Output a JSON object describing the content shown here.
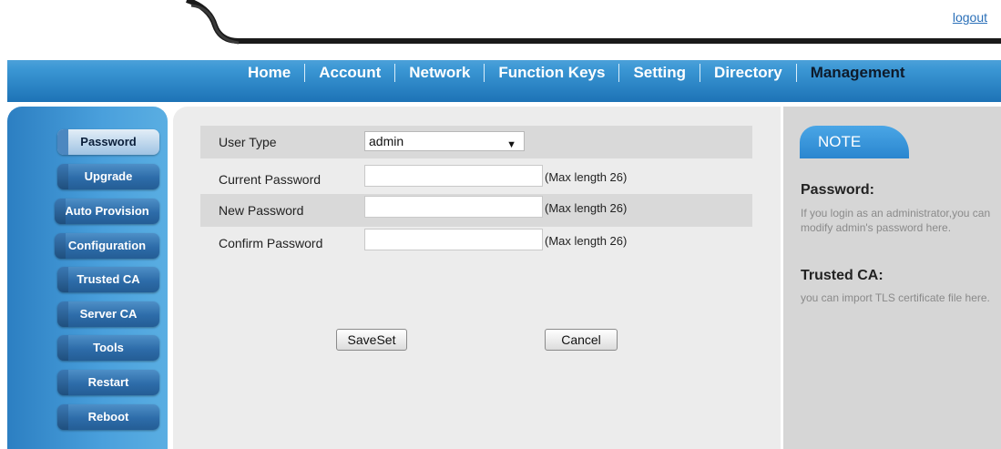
{
  "header": {
    "logout_label": "logout",
    "nav": [
      "Home",
      "Account",
      "Network",
      "Function Keys",
      "Setting",
      "Directory",
      "Management"
    ],
    "active_nav": "Management"
  },
  "sidebar": {
    "items": [
      "Password",
      "Upgrade",
      "Auto Provision",
      "Configuration",
      "Trusted CA",
      "Server CA",
      "Tools",
      "Restart",
      "Reboot"
    ],
    "active": "Password"
  },
  "form": {
    "user_type_label": "User Type",
    "user_type_value": "admin",
    "current_password_label": "Current Password",
    "new_password_label": "New Password",
    "confirm_password_label": "Confirm Password",
    "max_length_hint": "(Max length 26)",
    "save_label": "SaveSet",
    "cancel_label": "Cancel"
  },
  "note": {
    "title": "NOTE",
    "sections": [
      {
        "heading": "Password:",
        "text": "If you login as an administrator,you can modify admin's password here."
      },
      {
        "heading": "Trusted CA:",
        "text": "you can import TLS certificate file here."
      }
    ]
  },
  "colors": {
    "nav_gradient_top": "#6fb6e4",
    "nav_gradient_bottom": "#1d73b6",
    "sidebar_blue": "#3b90d0",
    "content_bg": "#ececec",
    "row_shade": "#d9d9d9",
    "note_bg": "#d6d6d6",
    "active_nav_text": "#0e1a2a",
    "link": "#2a6fb8"
  }
}
